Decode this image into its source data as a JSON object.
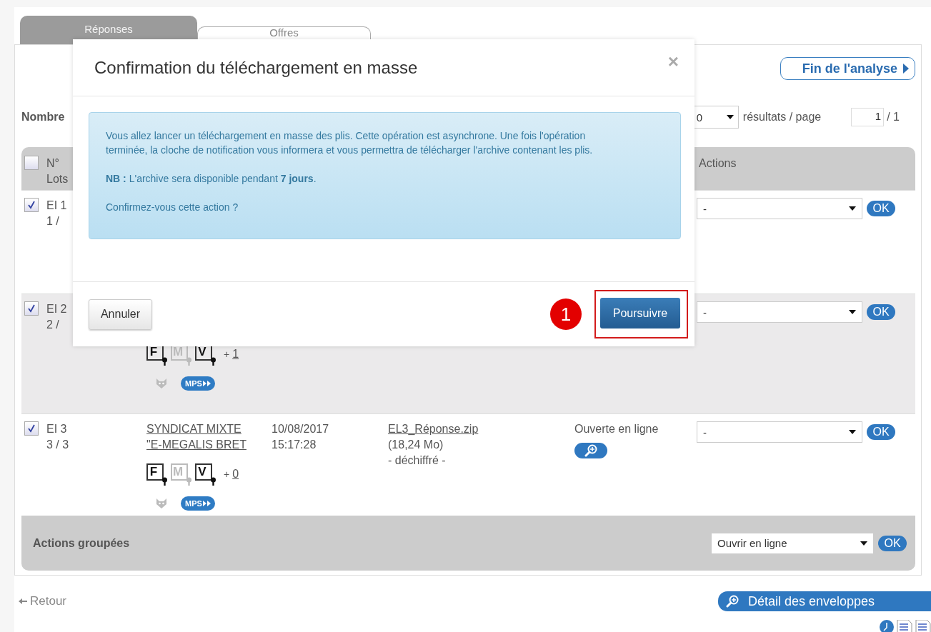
{
  "tabs": [
    {
      "label": "Réponses",
      "selected": true
    },
    {
      "label": "Offres",
      "selected": false
    }
  ],
  "header_button": "Fin de l'analyse",
  "count_label": "Nombre",
  "pagination": {
    "page_size": "0",
    "per_page_label": "résultats / page",
    "page": "1",
    "total": "/ 1"
  },
  "table": {
    "header_checked": false,
    "column_1": [
      "N°",
      "Lots"
    ],
    "actions_header": "Actions",
    "rows": [
      {
        "checked": true,
        "number": "EI 1",
        "lot": "1 /",
        "action": "-",
        "ok": "OK"
      },
      {
        "checked": true,
        "number": "EI 2",
        "lot": "2 /",
        "signatures": [
          {
            "letter": "F",
            "active": true
          },
          {
            "letter": "M",
            "active": false
          },
          {
            "letter": "V",
            "active": true
          }
        ],
        "extra_label": "+",
        "extra_count": "1",
        "badge": "MPS",
        "action": "-",
        "ok": "OK"
      },
      {
        "checked": true,
        "number": "EI 3",
        "lot": "3 / 3",
        "entity": [
          "SYNDICAT MIXTE",
          "\"E-MEGALIS BRET"
        ],
        "signatures": [
          {
            "letter": "F",
            "active": true
          },
          {
            "letter": "M",
            "active": false
          },
          {
            "letter": "V",
            "active": true
          }
        ],
        "extra_label": "+",
        "extra_count": "0",
        "badge": "MPS",
        "date": [
          "10/08/2017",
          "15:17:28"
        ],
        "file": "EL3_Réponse.zip",
        "size": "(18,24 Mo)",
        "file_state": "- déchiffré -",
        "status": "Ouverte en ligne",
        "action": "-",
        "ok": "OK"
      }
    ]
  },
  "grouped_actions": {
    "label": "Actions groupées",
    "value": "Ouvrir en ligne",
    "ok": "OK"
  },
  "back_link": "Retour",
  "detail_button": "Détail des enveloppes",
  "modal": {
    "title": "Confirmation du téléchargement en masse",
    "close": "×",
    "paragraphs": [
      "Vous allez lancer un téléchargement en masse des plis. Cette opération est asynchrone. Une fois l'opération terminée, la cloche de notification vous informera et vous permettra de télécharger l'archive contenant les plis.",
      "**NB :** L'archive sera disponible pendant **7 jours**.",
      "Confirmez-vous cette action ?"
    ],
    "cancel": "Annuler",
    "confirm": "Poursuivre",
    "callout": "1"
  }
}
